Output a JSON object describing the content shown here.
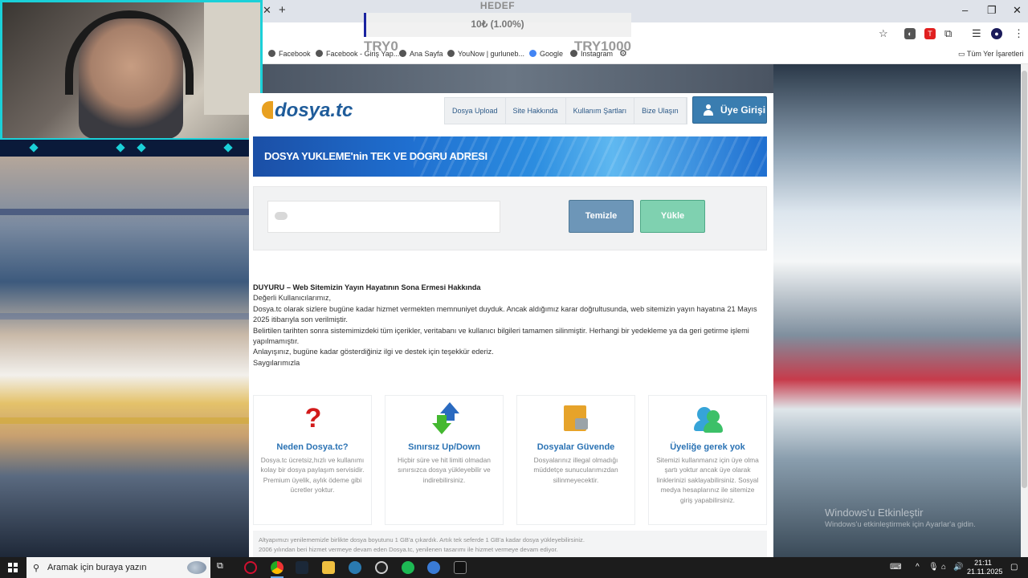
{
  "overlay": {
    "goal_title": "HEDEF",
    "goal_text": "10₺ (1.00%)",
    "goal_min": "TRY0",
    "goal_max": "TRY1000",
    "goal_progress_percent": 1.0
  },
  "browser": {
    "bookmarks": [
      "Facebook",
      "Facebook - Giriş Yap...",
      "Ana Sayfa",
      "YouNow | gurluneb...",
      "Google",
      "Instagram"
    ],
    "all_bookmarks": "Tüm Yer İşaretleri"
  },
  "site": {
    "logo": "dosya.tc",
    "nav": [
      "Dosya Upload",
      "Site Hakkında",
      "Kullanım Şartları",
      "Bize Ulaşın"
    ],
    "login_label": "Üye Girişi",
    "banner_text": "DOSYA YUKLEME'nin TEK VE DOGRU ADRESI",
    "clear_label": "Temizle",
    "upload_label": "Yükle",
    "notice": {
      "title": "DUYURU – Web Sitemizin Yayın Hayatının Sona Ermesi Hakkında",
      "greeting": "Değerli Kullanıcılarımız,",
      "p1": "Dosya.tc olarak sizlere bugüne kadar hizmet vermekten memnuniyet duyduk. Ancak aldığımız karar doğrultusunda, web sitemizin yayın hayatına 21 Mayıs 2025 itibarıyla son verilmiştir.",
      "p2": "Belirtilen tarihten sonra sistemimizdeki tüm içerikler, veritabanı ve kullanıcı bilgileri tamamen silinmiştir. Herhangi bir yedekleme ya da geri getirme işlemi yapılmamıştır.",
      "p3": "Anlayışınız, bugüne kadar gösterdiğiniz ilgi ve destek için teşekkür ederiz.",
      "sign": "Saygılarımızla"
    },
    "features": [
      {
        "title": "Neden Dosya.tc?",
        "text": "Dosya.tc ücretsiz,hızlı ve kullanımı kolay bir dosya paylaşım servisidir. Premium üyelik, aylık ödeme gibi ücretler yoktur."
      },
      {
        "title": "Sınırsız Up/Down",
        "text": "Hiçbir süre ve hit limiti olmadan sınırsızca dosya yükleyebilir ve indirebilirsiniz."
      },
      {
        "title": "Dosyalar Güvende",
        "text": "Dosyalarınız illegal olmadığı müddetçe sunucularımızdan silinmeyecektir."
      },
      {
        "title": "Üyeliğe gerek yok",
        "text": "Sitemizi kullanmanız için üye olma şartı yoktur ancak üye olarak linklerinizi saklayabilirsiniz. Sosyal medya hesaplarınız ile sitemize giriş yapabilirsiniz."
      }
    ],
    "footnote_1": "Altyapımızı yenilememizle birlikte dosya boyutunu 1 GB'a çıkardık. Artık tek seferde 1 GB'a kadar dosya yükleyebilirsiniz.",
    "footnote_2": "2006 yılından beri hizmet vermeye devam eden Dosya.tc, yenilenen tasarımı ile hizmet vermeye devam ediyor."
  },
  "windows": {
    "watermark_title": "Windows'u Etkinleştir",
    "watermark_sub": "Windows'u etkinleştirmek için Ayarlar'a gidin.",
    "search_placeholder": "Aramak için buraya yazın",
    "time": "21:11",
    "date": "21.11.2025"
  }
}
